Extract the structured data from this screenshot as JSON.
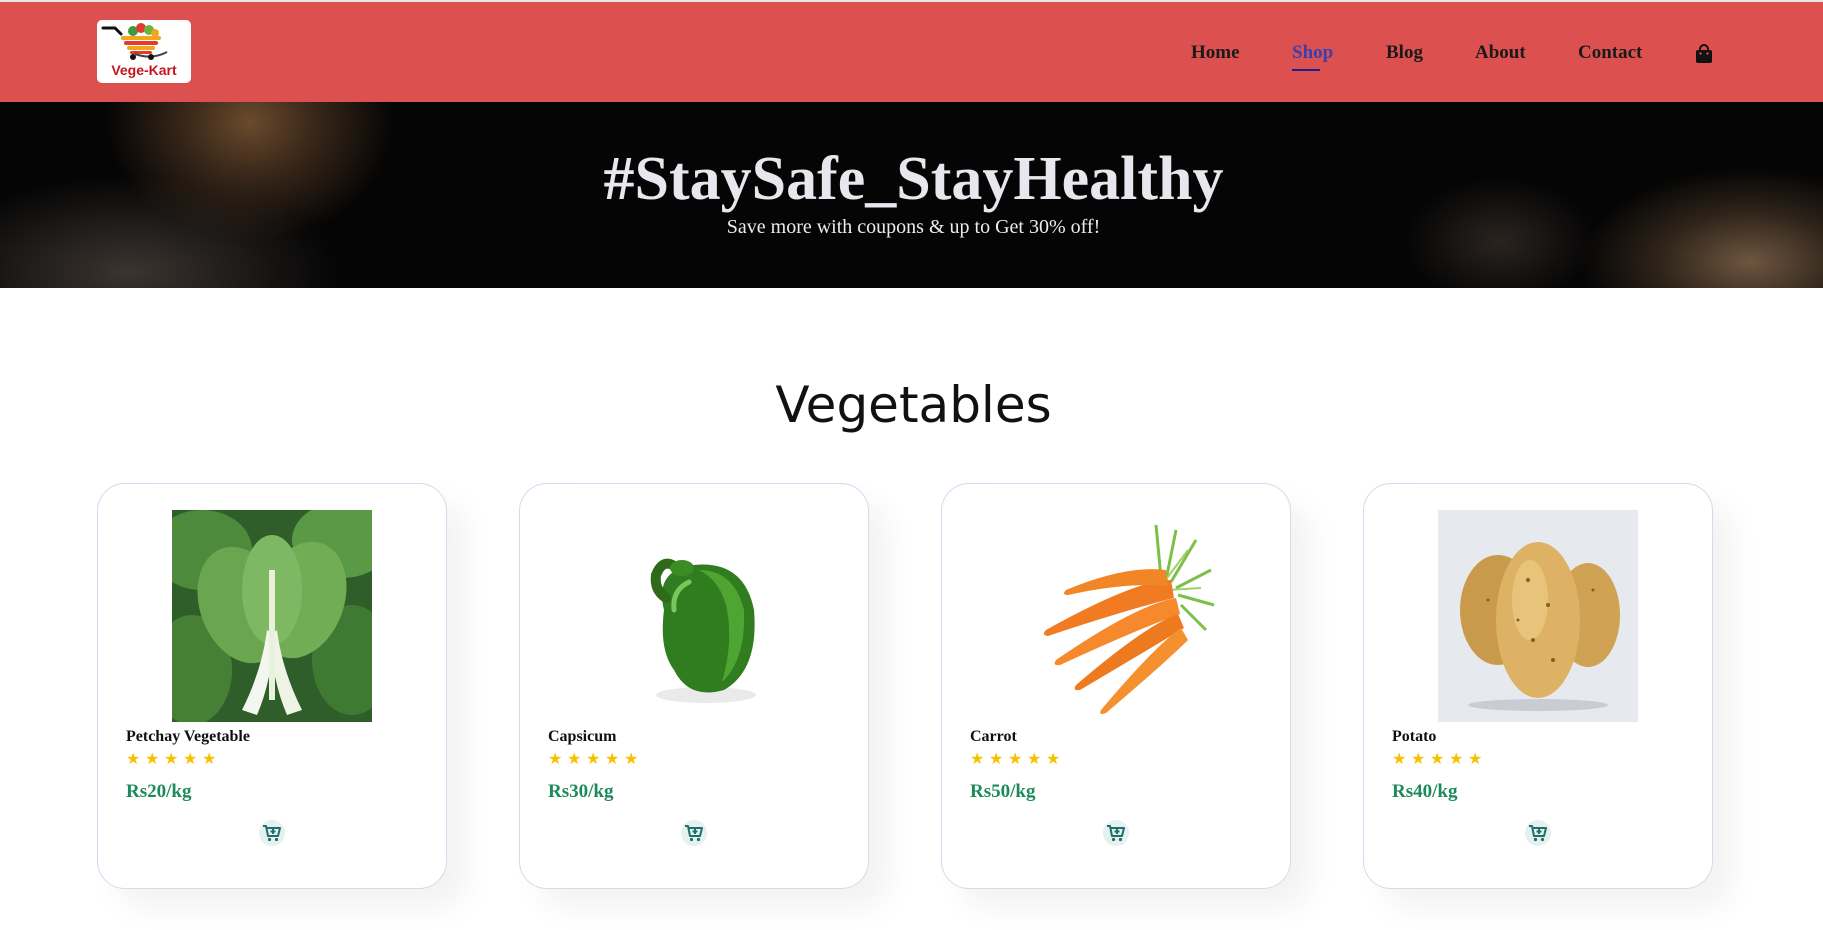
{
  "brand": {
    "logo_text": "Vege-Kart"
  },
  "nav": {
    "items": [
      {
        "label": "Home"
      },
      {
        "label": "Shop"
      },
      {
        "label": "Blog"
      },
      {
        "label": "About"
      },
      {
        "label": "Contact"
      }
    ],
    "active": "Shop",
    "cart_icon": "shopping-bag-icon"
  },
  "hero": {
    "title": "#StaySafe_StayHealthy",
    "subtitle": "Save more with coupons & up to Get 30% off!"
  },
  "section": {
    "title": "Vegetables"
  },
  "products": [
    {
      "name": "Petchay Vegetable",
      "rating": 5,
      "price": "Rs20/kg",
      "image_icon": "petchay-image"
    },
    {
      "name": "Capsicum",
      "rating": 5,
      "price": "Rs30/kg",
      "image_icon": "capsicum-image"
    },
    {
      "name": "Carrot",
      "rating": 5,
      "price": "Rs50/kg",
      "image_icon": "carrot-image"
    },
    {
      "name": "Potato",
      "rating": 5,
      "price": "Rs40/kg",
      "image_icon": "potato-image"
    }
  ],
  "colors": {
    "header_bg": "#dc5050",
    "nav_active": "#3a3fb0",
    "price": "#1c8a5a",
    "star": "#f5c200",
    "cart_button": "#1f6f6a"
  }
}
